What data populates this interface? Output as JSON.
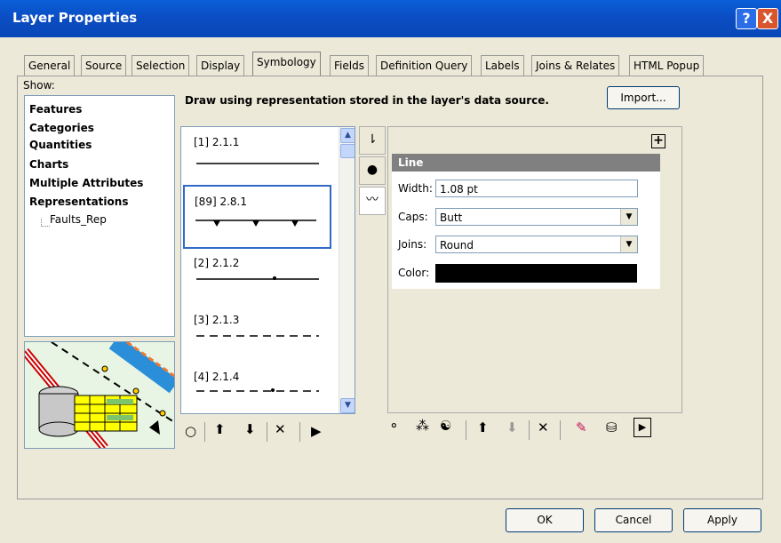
{
  "window": {
    "title": "Layer Properties",
    "help": "?",
    "close": "X"
  },
  "tabs": [
    "General",
    "Source",
    "Selection",
    "Display",
    "Symbology",
    "Fields",
    "Definition Query",
    "Labels",
    "Joins & Relates",
    "HTML Popup"
  ],
  "active_tab": "Symbology",
  "show": {
    "label": "Show:",
    "items": [
      "Features",
      "Categories",
      "Quantities",
      "Charts",
      "Multiple Attributes",
      "Representations"
    ],
    "subitem": "Faults_Rep"
  },
  "description": "Draw using representation stored in the layer's data source.",
  "import_label": "Import...",
  "rules": [
    "[1] 2.1.1",
    "[89] 2.8.1",
    "[2] 2.1.2",
    "[3] 2.1.3",
    "[4] 2.1.4"
  ],
  "line_props": {
    "header": "Line",
    "width_label": "Width:",
    "width_value": "1.08 pt",
    "caps_label": "Caps:",
    "caps_value": "Butt",
    "joins_label": "Joins:",
    "joins_value": "Round",
    "color_label": "Color:",
    "color_value": "#000000"
  },
  "plus": "+",
  "buttons": {
    "ok": "OK",
    "cancel": "Cancel",
    "apply": "Apply"
  },
  "colors": {
    "title_bar": "#0a5fd8",
    "selection": "#316ac5"
  }
}
